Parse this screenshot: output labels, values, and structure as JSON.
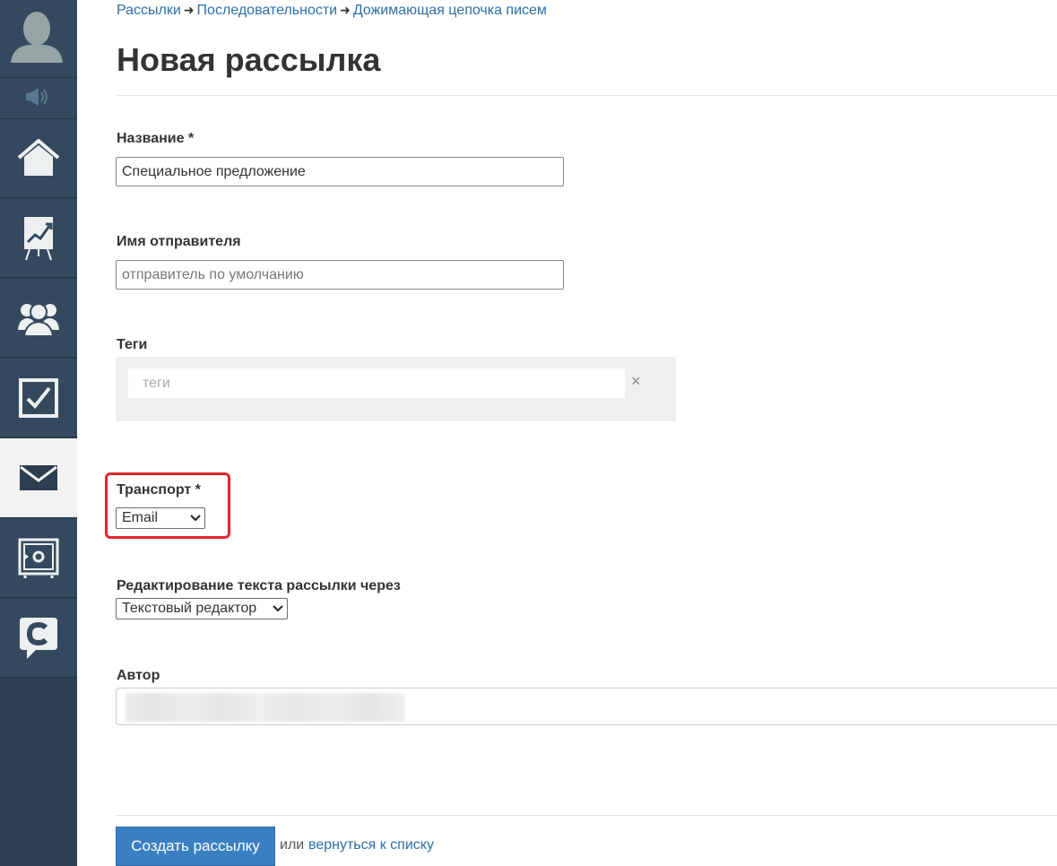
{
  "sidebar": {
    "items": [
      {
        "name": "home-icon",
        "active": false
      },
      {
        "name": "chart-board-icon",
        "active": false
      },
      {
        "name": "users-icon",
        "active": false
      },
      {
        "name": "checkbox-icon",
        "active": false
      },
      {
        "name": "envelope-icon",
        "active": true
      },
      {
        "name": "safe-icon",
        "active": false
      },
      {
        "name": "chat-c-icon",
        "active": false
      }
    ]
  },
  "breadcrumb": {
    "items": [
      "Рассылки",
      "Последовательности",
      "Дожимающая цепочка писем"
    ],
    "separator": "➜"
  },
  "page": {
    "title": "Новая рассылка"
  },
  "form": {
    "name": {
      "label": "Название *",
      "value": "Специальное предложение"
    },
    "sender": {
      "label": "Имя отправителя",
      "placeholder": "отправитель по умолчанию"
    },
    "tags": {
      "label": "Теги",
      "placeholder": "теги",
      "clear": "×"
    },
    "transport": {
      "label": "Транспорт *",
      "selected": "Email"
    },
    "editor": {
      "label": "Редактирование текста рассылки через",
      "selected": "Текстовый редактор"
    },
    "author": {
      "label": "Автор"
    }
  },
  "actions": {
    "submit": "Создать рассылку",
    "or": "или",
    "back": "вернуться к списку"
  },
  "colors": {
    "sidebar_bg": "#34495e",
    "accent": "#3a7fc1",
    "link": "#2b6fa8",
    "highlight": "#e0282e"
  }
}
